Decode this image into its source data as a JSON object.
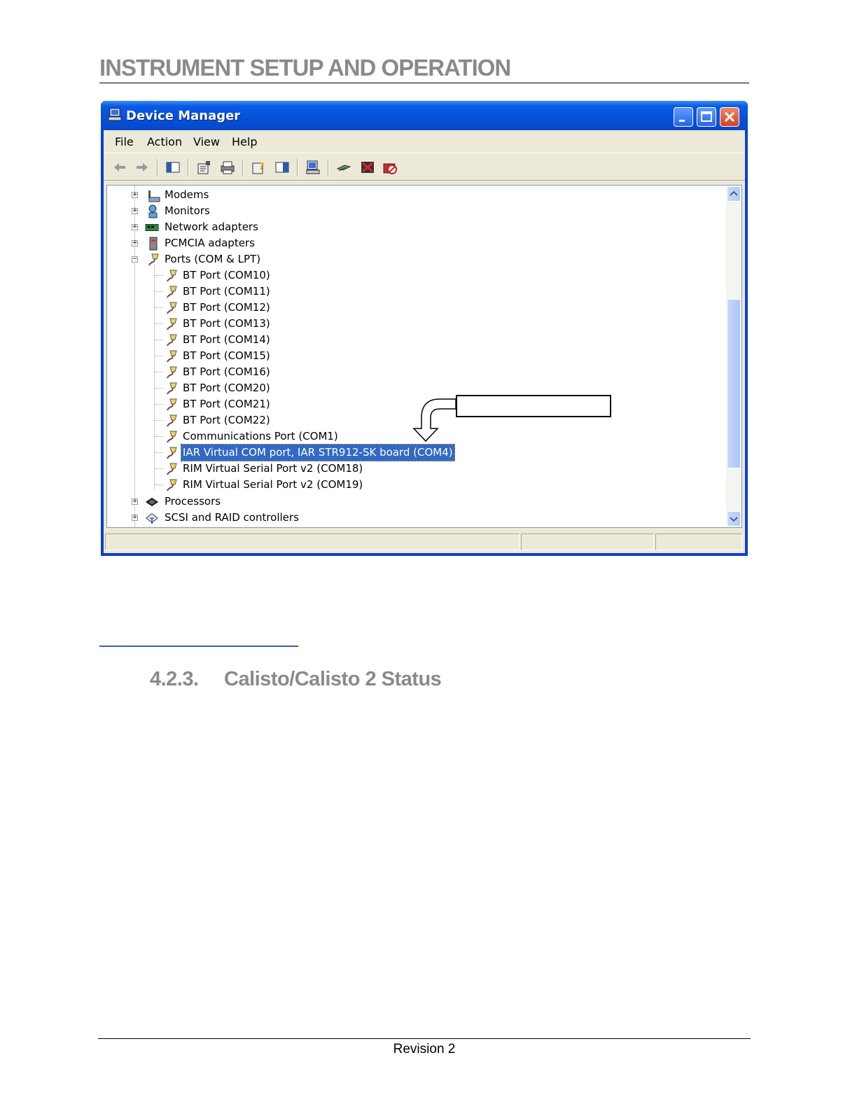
{
  "page": {
    "heading": "INSTRUMENT SETUP AND OPERATION",
    "section_number": "4.2.3.",
    "section_title": "Calisto/Calisto 2 Status",
    "footer": "Revision 2"
  },
  "window": {
    "title": "Device Manager",
    "title_icon": "computer-icon",
    "controls": [
      "minimize",
      "maximize",
      "close"
    ]
  },
  "menu": {
    "file": "File",
    "action": "Action",
    "view": "View",
    "help": "Help"
  },
  "toolbar": [
    "back-arrow-icon",
    "forward-arrow-icon",
    "show-hide-tree-icon",
    "properties-icon",
    "print-icon",
    "help-icon",
    "view-icon",
    "scan-hardware-icon",
    "update-driver-icon",
    "uninstall-icon",
    "disable-icon"
  ],
  "tree": {
    "categories_top": [
      {
        "label": "Modems",
        "icon": "modem-icon"
      },
      {
        "label": "Monitors",
        "icon": "monitor-icon"
      },
      {
        "label": "Network adapters",
        "icon": "network-adapter-icon"
      },
      {
        "label": "PCMCIA adapters",
        "icon": "pcmcia-icon"
      }
    ],
    "ports": {
      "label": "Ports (COM & LPT)",
      "children": [
        "BT Port (COM10)",
        "BT Port (COM11)",
        "BT Port (COM12)",
        "BT Port (COM13)",
        "BT Port (COM14)",
        "BT Port (COM15)",
        "BT Port (COM16)",
        "BT Port (COM20)",
        "BT Port (COM21)",
        "BT Port (COM22)",
        "Communications Port (COM1)",
        "IAR Virtual COM port, IAR STR912-SK board (COM4)",
        "RIM Virtual Serial Port v2 (COM18)",
        "RIM Virtual Serial Port v2 (COM19)"
      ],
      "selected": "IAR Virtual COM port, IAR STR912-SK board (COM4)"
    },
    "categories_bottom": [
      {
        "label": "Processors",
        "icon": "processor-icon"
      },
      {
        "label": "SCSI and RAID controllers",
        "icon": "scsi-icon"
      }
    ]
  },
  "colors": {
    "heading_gray": "#8a8a8a",
    "xp_title_blue": "#0550d8",
    "selection": "#316ac5",
    "window_face": "#ece9d8"
  }
}
